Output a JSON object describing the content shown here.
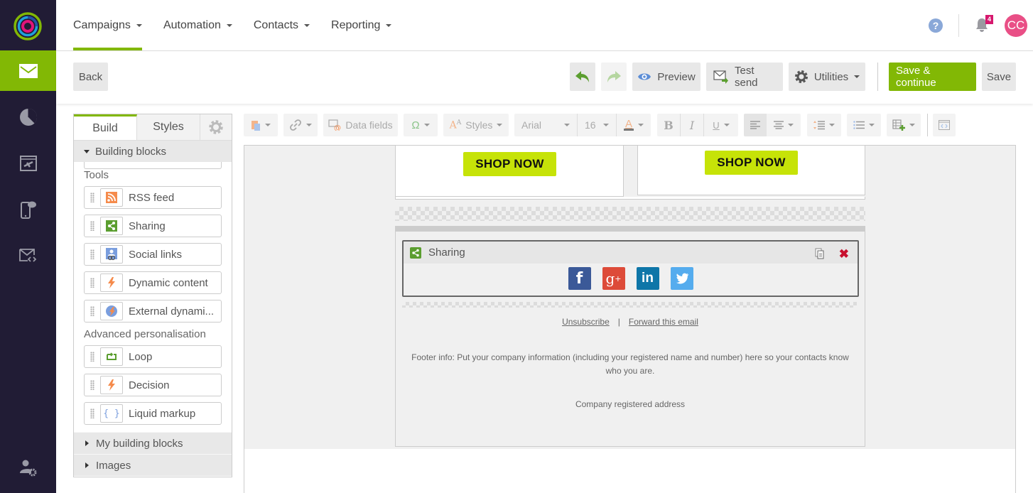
{
  "brand": {
    "accent": "#82b805",
    "nav_bg": "#211c35",
    "cta_color": "#c6e308"
  },
  "topnav": {
    "items": [
      {
        "label": "Campaigns",
        "active": true
      },
      {
        "label": "Automation"
      },
      {
        "label": "Contacts"
      },
      {
        "label": "Reporting"
      }
    ],
    "help_icon": "?",
    "notifications_count": "4",
    "avatar_initials": "CC"
  },
  "leftnav": {
    "items": [
      {
        "icon": "envelope-icon",
        "active": true
      },
      {
        "icon": "pie-chart-icon"
      },
      {
        "icon": "landing-page-icon"
      },
      {
        "icon": "mobile-sms-icon"
      },
      {
        "icon": "email-code-icon"
      }
    ],
    "bottom_icon": "user-settings-icon"
  },
  "actionbar": {
    "back": "Back",
    "preview": "Preview",
    "test_send": "Test send",
    "utilities": "Utilities",
    "save_continue": "Save & continue",
    "save": "Save"
  },
  "panel": {
    "tabs": {
      "build": "Build",
      "styles": "Styles"
    },
    "building_blocks": "Building blocks",
    "groups": {
      "tools": "Tools",
      "advanced": "Advanced personalisation"
    },
    "tools": [
      {
        "label": "RSS feed",
        "icon": "rss-icon"
      },
      {
        "label": "Sharing",
        "icon": "share-icon"
      },
      {
        "label": "Social links",
        "icon": "social-links-icon"
      },
      {
        "label": "Dynamic content",
        "icon": "lightning-icon"
      },
      {
        "label": "External dynami...",
        "icon": "external-dynamic-icon"
      }
    ],
    "advanced": [
      {
        "label": "Loop",
        "icon": "loop-icon"
      },
      {
        "label": "Decision",
        "icon": "lightning-icon"
      },
      {
        "label": "Liquid markup",
        "icon": "braces-icon"
      }
    ],
    "my_building_blocks": "My building blocks",
    "images": "Images"
  },
  "editor_toolbar": {
    "data_fields": "Data fields",
    "styles": "Styles",
    "font": "Arial",
    "font_size": "16",
    "bold": "B",
    "italic": "I",
    "underline": "U"
  },
  "canvas": {
    "shop_now_left": "SHOP NOW",
    "shop_now_right": "SHOP NOW",
    "sharing_block_title": "Sharing",
    "social": [
      {
        "name": "facebook",
        "glyph": "f",
        "color": "#3b5998"
      },
      {
        "name": "google-plus",
        "glyph": "g+",
        "color": "#dd4b39"
      },
      {
        "name": "linkedin",
        "glyph": "in",
        "color": "#0e76a8"
      },
      {
        "name": "twitter",
        "glyph": "t",
        "color": "#55acee"
      }
    ],
    "unsubscribe": "Unsubscribe",
    "separator": "|",
    "forward": "Forward this email",
    "footer_info": "Footer info: Put your company information (including your registered name and number) here so your contacts know who you are.",
    "company_address": "Company registered address"
  }
}
